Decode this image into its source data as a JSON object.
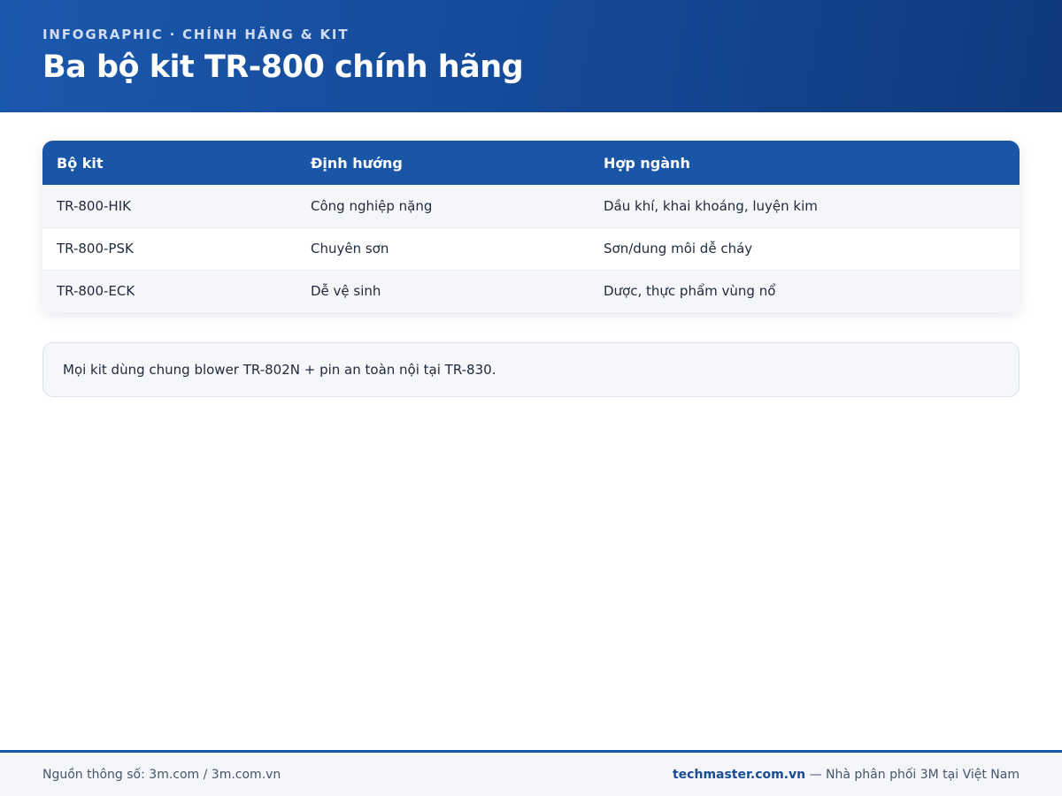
{
  "header": {
    "eyebrow": "INFOGRAPHIC · CHÍNH HÃNG & KIT",
    "title": "Ba bộ kit TR-800 chính hãng"
  },
  "table": {
    "columns": [
      "Bộ kit",
      "Định hướng",
      "Hợp ngành"
    ],
    "rows": [
      [
        "TR-800-HIK",
        "Công nghiệp nặng",
        "Dầu khí, khai khoáng, luyện kim"
      ],
      [
        "TR-800-PSK",
        "Chuyên sơn",
        "Sơn/dung môi dễ cháy"
      ],
      [
        "TR-800-ECK",
        "Dễ vệ sinh",
        "Dược, thực phẩm vùng nổ"
      ]
    ]
  },
  "note": "Mọi kit dùng chung blower TR-802N + pin an toàn nội tại TR-830.",
  "footer": {
    "source": "Nguồn thông số: 3m.com / 3m.com.vn",
    "brand": "techmaster.com.vn",
    "tagline": " — Nhà phân phối 3M tại Việt Nam"
  },
  "colors": {
    "header_blue": "#1a56a8",
    "brand_text": "#1a4c94"
  }
}
